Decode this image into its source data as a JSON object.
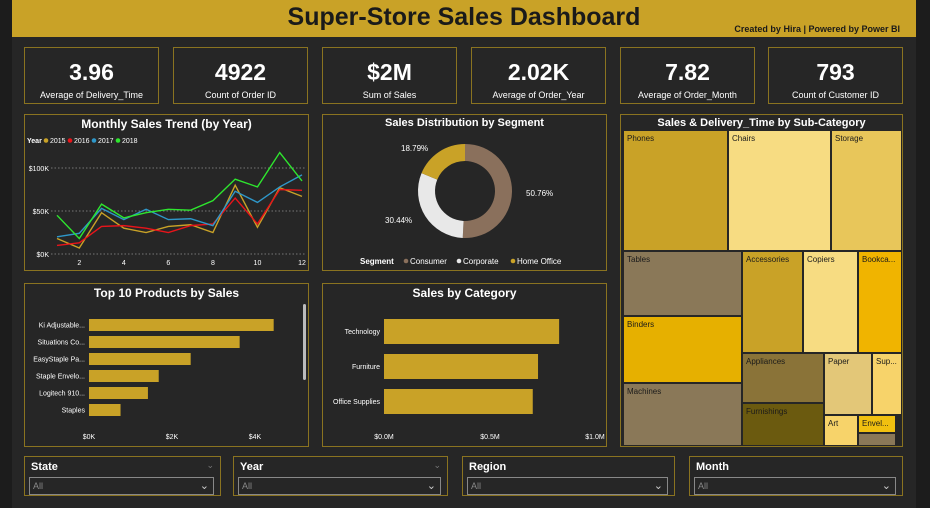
{
  "header": {
    "title": "Super-Store Sales Dashboard",
    "credit": "Created by Hira | Powered by Power BI"
  },
  "kpis": [
    {
      "value": "3.96",
      "label": "Average of Delivery_Time"
    },
    {
      "value": "4922",
      "label": "Count of Order ID"
    },
    {
      "value": "$2M",
      "label": "Sum of Sales"
    },
    {
      "value": "2.02K",
      "label": "Average of Order_Year"
    },
    {
      "value": "7.82",
      "label": "Average of Order_Month"
    },
    {
      "value": "793",
      "label": "Count of Customer ID"
    }
  ],
  "colors": {
    "gold": "#c9a227",
    "panel": "#262626",
    "border": "#8a7320",
    "y2015": "#c9a227",
    "y2016": "#e8141a",
    "y2017": "#2e97c9",
    "y2018": "#2ee62e",
    "consumer": "#8a705c",
    "corporate": "#e8e8e8",
    "home_office": "#c9a227"
  },
  "trend": {
    "title": "Monthly Sales Trend (by Year)",
    "legend_title": "Year",
    "legend": [
      "2015",
      "2016",
      "2017",
      "2018"
    ],
    "y_ticks": [
      "$100K",
      "$50K",
      "$0K"
    ],
    "x_ticks": [
      "2",
      "4",
      "6",
      "8",
      "10",
      "12"
    ]
  },
  "segment": {
    "title": "Sales Distribution by Segment",
    "labels": [
      "50.76%",
      "30.44%",
      "18.79%"
    ],
    "legend_title": "Segment",
    "legend": [
      "Consumer",
      "Corporate",
      "Home Office"
    ]
  },
  "treemap": {
    "title": "Sales & Delivery_Time by Sub-Category",
    "cells": [
      "Phones",
      "Chairs",
      "Storage",
      "Tables",
      "Accessories",
      "Copiers",
      "Bookca...",
      "Binders",
      "Appliances",
      "Paper",
      "Sup...",
      "Machines",
      "Furnishings",
      "Art",
      "Envel..."
    ]
  },
  "products": {
    "title": "Top 10 Products by Sales",
    "x_ticks": [
      "$0K",
      "$2K",
      "$4K"
    ]
  },
  "category": {
    "title": "Sales by Category",
    "x_ticks": [
      "$0.0M",
      "$0.5M",
      "$1.0M"
    ]
  },
  "slicers": [
    {
      "title": "State",
      "value": "All"
    },
    {
      "title": "Year",
      "value": "All"
    },
    {
      "title": "Region",
      "value": "All"
    },
    {
      "title": "Month",
      "value": "All"
    }
  ],
  "chart_data": [
    {
      "type": "line",
      "title": "Monthly Sales Trend (by Year)",
      "x": [
        1,
        2,
        3,
        4,
        5,
        6,
        7,
        8,
        9,
        10,
        11,
        12
      ],
      "ylim": [
        0,
        115000
      ],
      "series": [
        {
          "name": "2015",
          "values": [
            18000,
            7000,
            48000,
            30000,
            25000,
            32000,
            34000,
            25000,
            80000,
            31000,
            77000,
            67000
          ]
        },
        {
          "name": "2016",
          "values": [
            10000,
            13000,
            32000,
            33000,
            30000,
            25000,
            33000,
            35000,
            65000,
            35000,
            75000,
            74000
          ]
        },
        {
          "name": "2017",
          "values": [
            20000,
            24000,
            53000,
            40000,
            52000,
            40000,
            41000,
            33000,
            73000,
            60000,
            78000,
            92000
          ]
        },
        {
          "name": "2018",
          "values": [
            45000,
            18000,
            58000,
            42000,
            48000,
            52000,
            51000,
            62000,
            87000,
            78000,
            118000,
            85000
          ]
        }
      ]
    },
    {
      "type": "pie",
      "title": "Sales Distribution by Segment",
      "categories": [
        "Consumer",
        "Corporate",
        "Home Office"
      ],
      "values": [
        50.76,
        30.44,
        18.79
      ]
    },
    {
      "type": "bar",
      "title": "Top 10 Products by Sales",
      "categories": [
        "Ki Adjustable...",
        "Situations Co...",
        "EasyStaple Pa...",
        "Staple Envelo...",
        "Logitech 910...",
        "Staples"
      ],
      "values": [
        4450,
        3630,
        2450,
        1680,
        1420,
        760
      ],
      "xlim": [
        0,
        5000
      ]
    },
    {
      "type": "bar",
      "title": "Sales by Category",
      "categories": [
        "Technology",
        "Furniture",
        "Office Supplies"
      ],
      "values": [
        830000,
        730000,
        705000
      ],
      "xlim": [
        0,
        1000000
      ]
    }
  ]
}
